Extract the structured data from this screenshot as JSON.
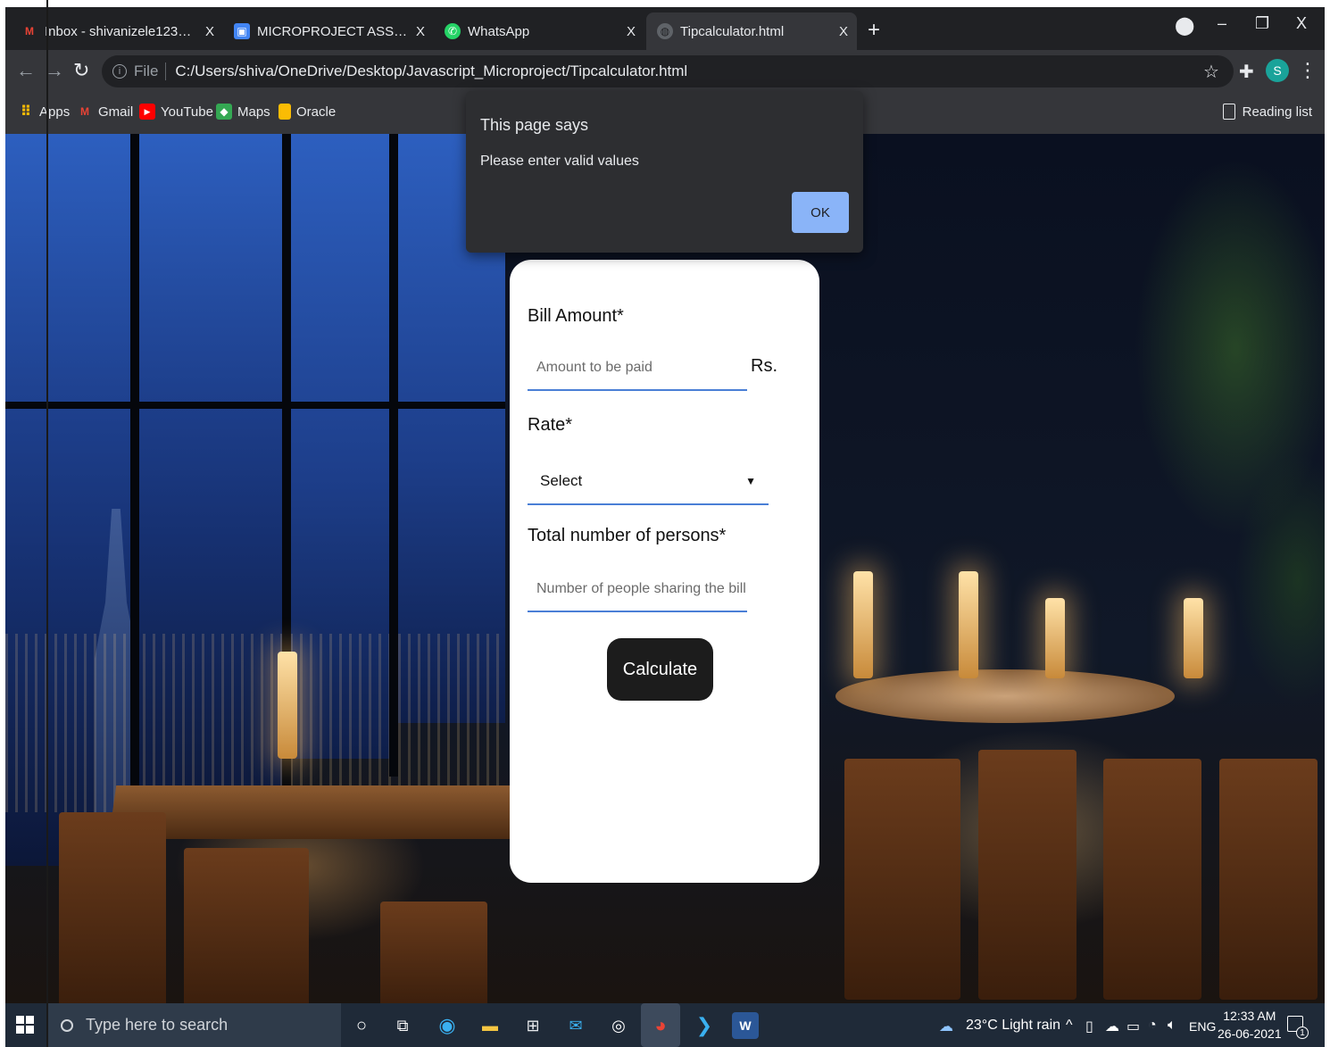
{
  "browser": {
    "tabs": [
      {
        "title": "Inbox - shivanizele123@gmail.co",
        "icon": "gmail-icon",
        "close": "X"
      },
      {
        "title": "MICROPROJECT ASSIGNMENTS |",
        "icon": "classroom-icon",
        "close": "X"
      },
      {
        "title": "WhatsApp",
        "icon": "whatsapp-icon",
        "close": "X"
      },
      {
        "title": "Tipcalculator.html",
        "icon": "globe-icon",
        "close": "X",
        "active": true
      }
    ],
    "new_tab": "+",
    "window_controls": {
      "minimize": "–",
      "restore": "❐",
      "close": "X"
    },
    "address": {
      "scheme": "File",
      "url": "C:/Users/shiva/OneDrive/Desktop/Javascript_Microproject/Tipcalculator.html"
    },
    "profile_initial": "S",
    "bookmarks": [
      {
        "label": "Apps",
        "icon": "apps-grid-icon"
      },
      {
        "label": "Gmail",
        "icon": "gmail-icon"
      },
      {
        "label": "YouTube",
        "icon": "youtube-icon"
      },
      {
        "label": "Maps",
        "icon": "maps-icon"
      },
      {
        "label": "Oracle",
        "icon": "folder-icon"
      }
    ],
    "reading_list": "Reading list"
  },
  "alert": {
    "title": "This page says",
    "message": "Please enter valid values",
    "ok_label": "OK"
  },
  "form": {
    "bill_label": "Bill Amount*",
    "bill_placeholder": "Amount to be paid",
    "bill_unit": "Rs.",
    "rate_label": "Rate*",
    "rate_selected": "Select",
    "persons_label": "Total number of persons*",
    "persons_placeholder": "Number of people sharing the bill",
    "calculate_label": "Calculate"
  },
  "taskbar": {
    "search_placeholder": "Type here to search",
    "weather": "23°C  Light rain",
    "language": "ENG",
    "time": "12:33 AM",
    "date": "26-06-2021",
    "notification_count": "1"
  },
  "colors": {
    "field_underline": "#4a7fd6",
    "ok_button": "#8ab4f8",
    "calc_button": "#1c1c1c",
    "taskbar": "#1f2a38"
  }
}
